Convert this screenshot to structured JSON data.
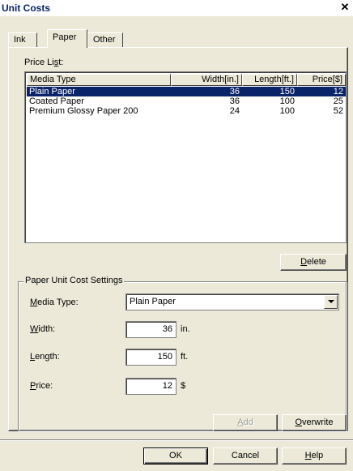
{
  "window": {
    "title": "Unit Costs",
    "close_glyph": "✕"
  },
  "tabs": [
    {
      "label": "Ink",
      "active": false
    },
    {
      "label": "Paper",
      "active": true
    },
    {
      "label": "Other",
      "active": false
    }
  ],
  "price_list": {
    "label": "Price List:",
    "columns": [
      "Media Type",
      "Width[in.]",
      "Length[ft.]",
      "Price[$]"
    ],
    "rows": [
      {
        "media": "Plain Paper",
        "width": "36",
        "length": "150",
        "price": "12",
        "selected": true
      },
      {
        "media": "Coated Paper",
        "width": "36",
        "length": "100",
        "price": "25",
        "selected": false
      },
      {
        "media": "Premium Glossy Paper 200",
        "width": "24",
        "length": "100",
        "price": "52",
        "selected": false
      }
    ]
  },
  "buttons": {
    "delete": "Delete",
    "add": "Add",
    "overwrite": "Overwrite",
    "ok": "OK",
    "cancel": "Cancel",
    "help": "Help"
  },
  "settings": {
    "group_title": "Paper Unit Cost Settings",
    "media_type_label": "Media Type:",
    "media_type_value": "Plain Paper",
    "width_label": "Width:",
    "width_value": "36",
    "width_unit": "in.",
    "length_label": "Length:",
    "length_value": "150",
    "length_unit": "ft.",
    "price_label": "Price:",
    "price_value": "12",
    "price_unit": "$"
  },
  "colors": {
    "dialog_bg": "#ece9d8",
    "selection": "#0a246a",
    "title_text": "#0a246a"
  }
}
